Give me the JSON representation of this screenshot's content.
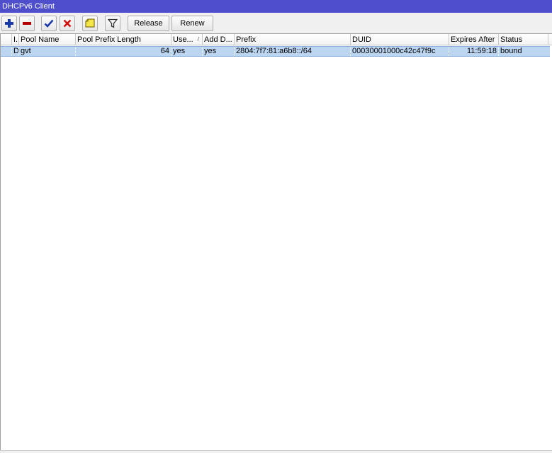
{
  "window": {
    "title": "DHCPv6 Client"
  },
  "toolbar": {
    "add_icon": "plus-icon",
    "remove_icon": "minus-icon",
    "enable_icon": "check-icon",
    "disable_icon": "cross-icon",
    "comment_icon": "note-icon",
    "filter_icon": "filter-icon",
    "release_label": "Release",
    "renew_label": "Renew"
  },
  "table": {
    "columns": [
      "I.",
      "Pool Name",
      "Pool Prefix Length",
      "Use...",
      "Add D...",
      "Prefix",
      "DUID",
      "Expires After",
      "Status"
    ],
    "rows": [
      {
        "flag": "D",
        "pool_name": "gvt",
        "pool_prefix_length": "64",
        "use_peer_dns": "yes",
        "add_default_route": "yes",
        "prefix": "2804:7f7:81:a6b8::/64",
        "duid": "00030001000c42c47f9c",
        "expires_after": "11:59:18",
        "status": "bound"
      }
    ]
  },
  "colors": {
    "titlebar": "#4f4fce",
    "selected_row": "#bcd6f2",
    "add_icon": "#1a3aa8",
    "remove_icon": "#b00000",
    "enable_icon": "#1a3aa8",
    "disable_icon": "#d01010"
  }
}
